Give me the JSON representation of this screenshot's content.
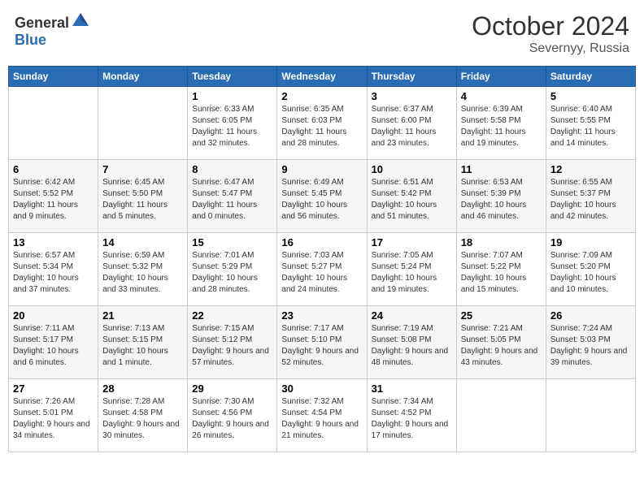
{
  "header": {
    "logo_general": "General",
    "logo_blue": "Blue",
    "month_year": "October 2024",
    "location": "Severnyy, Russia"
  },
  "weekdays": [
    "Sunday",
    "Monday",
    "Tuesday",
    "Wednesday",
    "Thursday",
    "Friday",
    "Saturday"
  ],
  "weeks": [
    [
      {
        "day": "",
        "sunrise": "",
        "sunset": "",
        "daylight": ""
      },
      {
        "day": "",
        "sunrise": "",
        "sunset": "",
        "daylight": ""
      },
      {
        "day": "1",
        "sunrise": "Sunrise: 6:33 AM",
        "sunset": "Sunset: 6:05 PM",
        "daylight": "Daylight: 11 hours and 32 minutes."
      },
      {
        "day": "2",
        "sunrise": "Sunrise: 6:35 AM",
        "sunset": "Sunset: 6:03 PM",
        "daylight": "Daylight: 11 hours and 28 minutes."
      },
      {
        "day": "3",
        "sunrise": "Sunrise: 6:37 AM",
        "sunset": "Sunset: 6:00 PM",
        "daylight": "Daylight: 11 hours and 23 minutes."
      },
      {
        "day": "4",
        "sunrise": "Sunrise: 6:39 AM",
        "sunset": "Sunset: 5:58 PM",
        "daylight": "Daylight: 11 hours and 19 minutes."
      },
      {
        "day": "5",
        "sunrise": "Sunrise: 6:40 AM",
        "sunset": "Sunset: 5:55 PM",
        "daylight": "Daylight: 11 hours and 14 minutes."
      }
    ],
    [
      {
        "day": "6",
        "sunrise": "Sunrise: 6:42 AM",
        "sunset": "Sunset: 5:52 PM",
        "daylight": "Daylight: 11 hours and 9 minutes."
      },
      {
        "day": "7",
        "sunrise": "Sunrise: 6:45 AM",
        "sunset": "Sunset: 5:50 PM",
        "daylight": "Daylight: 11 hours and 5 minutes."
      },
      {
        "day": "8",
        "sunrise": "Sunrise: 6:47 AM",
        "sunset": "Sunset: 5:47 PM",
        "daylight": "Daylight: 11 hours and 0 minutes."
      },
      {
        "day": "9",
        "sunrise": "Sunrise: 6:49 AM",
        "sunset": "Sunset: 5:45 PM",
        "daylight": "Daylight: 10 hours and 56 minutes."
      },
      {
        "day": "10",
        "sunrise": "Sunrise: 6:51 AM",
        "sunset": "Sunset: 5:42 PM",
        "daylight": "Daylight: 10 hours and 51 minutes."
      },
      {
        "day": "11",
        "sunrise": "Sunrise: 6:53 AM",
        "sunset": "Sunset: 5:39 PM",
        "daylight": "Daylight: 10 hours and 46 minutes."
      },
      {
        "day": "12",
        "sunrise": "Sunrise: 6:55 AM",
        "sunset": "Sunset: 5:37 PM",
        "daylight": "Daylight: 10 hours and 42 minutes."
      }
    ],
    [
      {
        "day": "13",
        "sunrise": "Sunrise: 6:57 AM",
        "sunset": "Sunset: 5:34 PM",
        "daylight": "Daylight: 10 hours and 37 minutes."
      },
      {
        "day": "14",
        "sunrise": "Sunrise: 6:59 AM",
        "sunset": "Sunset: 5:32 PM",
        "daylight": "Daylight: 10 hours and 33 minutes."
      },
      {
        "day": "15",
        "sunrise": "Sunrise: 7:01 AM",
        "sunset": "Sunset: 5:29 PM",
        "daylight": "Daylight: 10 hours and 28 minutes."
      },
      {
        "day": "16",
        "sunrise": "Sunrise: 7:03 AM",
        "sunset": "Sunset: 5:27 PM",
        "daylight": "Daylight: 10 hours and 24 minutes."
      },
      {
        "day": "17",
        "sunrise": "Sunrise: 7:05 AM",
        "sunset": "Sunset: 5:24 PM",
        "daylight": "Daylight: 10 hours and 19 minutes."
      },
      {
        "day": "18",
        "sunrise": "Sunrise: 7:07 AM",
        "sunset": "Sunset: 5:22 PM",
        "daylight": "Daylight: 10 hours and 15 minutes."
      },
      {
        "day": "19",
        "sunrise": "Sunrise: 7:09 AM",
        "sunset": "Sunset: 5:20 PM",
        "daylight": "Daylight: 10 hours and 10 minutes."
      }
    ],
    [
      {
        "day": "20",
        "sunrise": "Sunrise: 7:11 AM",
        "sunset": "Sunset: 5:17 PM",
        "daylight": "Daylight: 10 hours and 6 minutes."
      },
      {
        "day": "21",
        "sunrise": "Sunrise: 7:13 AM",
        "sunset": "Sunset: 5:15 PM",
        "daylight": "Daylight: 10 hours and 1 minute."
      },
      {
        "day": "22",
        "sunrise": "Sunrise: 7:15 AM",
        "sunset": "Sunset: 5:12 PM",
        "daylight": "Daylight: 9 hours and 57 minutes."
      },
      {
        "day": "23",
        "sunrise": "Sunrise: 7:17 AM",
        "sunset": "Sunset: 5:10 PM",
        "daylight": "Daylight: 9 hours and 52 minutes."
      },
      {
        "day": "24",
        "sunrise": "Sunrise: 7:19 AM",
        "sunset": "Sunset: 5:08 PM",
        "daylight": "Daylight: 9 hours and 48 minutes."
      },
      {
        "day": "25",
        "sunrise": "Sunrise: 7:21 AM",
        "sunset": "Sunset: 5:05 PM",
        "daylight": "Daylight: 9 hours and 43 minutes."
      },
      {
        "day": "26",
        "sunrise": "Sunrise: 7:24 AM",
        "sunset": "Sunset: 5:03 PM",
        "daylight": "Daylight: 9 hours and 39 minutes."
      }
    ],
    [
      {
        "day": "27",
        "sunrise": "Sunrise: 7:26 AM",
        "sunset": "Sunset: 5:01 PM",
        "daylight": "Daylight: 9 hours and 34 minutes."
      },
      {
        "day": "28",
        "sunrise": "Sunrise: 7:28 AM",
        "sunset": "Sunset: 4:58 PM",
        "daylight": "Daylight: 9 hours and 30 minutes."
      },
      {
        "day": "29",
        "sunrise": "Sunrise: 7:30 AM",
        "sunset": "Sunset: 4:56 PM",
        "daylight": "Daylight: 9 hours and 26 minutes."
      },
      {
        "day": "30",
        "sunrise": "Sunrise: 7:32 AM",
        "sunset": "Sunset: 4:54 PM",
        "daylight": "Daylight: 9 hours and 21 minutes."
      },
      {
        "day": "31",
        "sunrise": "Sunrise: 7:34 AM",
        "sunset": "Sunset: 4:52 PM",
        "daylight": "Daylight: 9 hours and 17 minutes."
      },
      {
        "day": "",
        "sunrise": "",
        "sunset": "",
        "daylight": ""
      },
      {
        "day": "",
        "sunrise": "",
        "sunset": "",
        "daylight": ""
      }
    ]
  ]
}
